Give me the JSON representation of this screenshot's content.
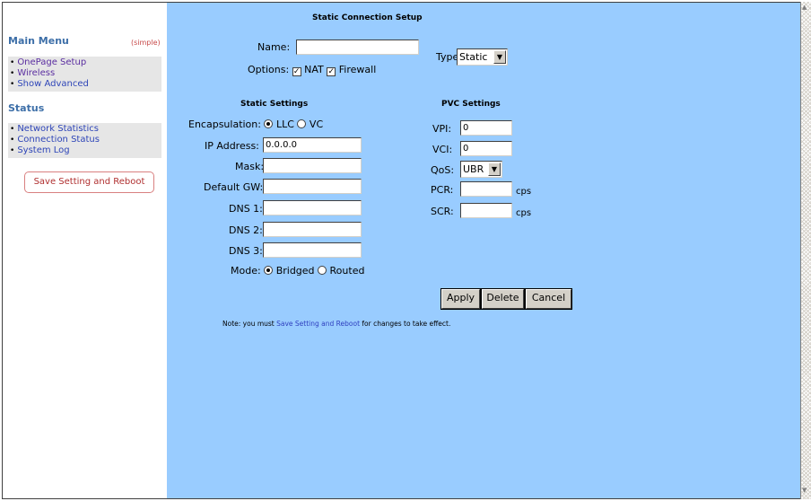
{
  "sidebar": {
    "main_menu_title": "Main Menu",
    "simple_link": "(simple)",
    "main_items": [
      {
        "label": "OnePage Setup"
      },
      {
        "label": "Wireless"
      },
      {
        "label": "Show Advanced"
      }
    ],
    "status_title": "Status",
    "status_items": [
      {
        "label": "Network Statistics"
      },
      {
        "label": "Connection Status"
      },
      {
        "label": "System Log"
      }
    ],
    "save_button": "Save Setting and Reboot"
  },
  "form": {
    "title": "Static Connection Setup",
    "name_label": "Name:",
    "name_value": "",
    "type_label": "Type:",
    "type_value": "Static",
    "options_label": "Options:",
    "nat_label": "NAT",
    "nat_checked": true,
    "firewall_label": "Firewall",
    "firewall_checked": true,
    "static_heading": "Static Settings",
    "pvc_heading": "PVC Settings",
    "encapsulation_label": "Encapsulation:",
    "llc_label": "LLC",
    "vc_label": "VC",
    "encapsulation_selected": "LLC",
    "ip_label": "IP Address:",
    "ip_value": "0.0.0.0",
    "mask_label": "Mask:",
    "mask_value": "",
    "gw_label": "Default GW:",
    "gw_value": "",
    "dns1_label": "DNS 1:",
    "dns1_value": "",
    "dns2_label": "DNS 2:",
    "dns2_value": "",
    "dns3_label": "DNS 3:",
    "dns3_value": "",
    "mode_label": "Mode:",
    "bridged_label": "Bridged",
    "routed_label": "Routed",
    "mode_selected": "Bridged",
    "vpi_label": "VPI:",
    "vpi_value": "0",
    "vci_label": "VCI:",
    "vci_value": "0",
    "qos_label": "QoS:",
    "qos_value": "UBR",
    "pcr_label": "PCR:",
    "pcr_value": "",
    "pcr_unit": "cps",
    "scr_label": "SCR:",
    "scr_value": "",
    "scr_unit": "cps",
    "apply_button": "Apply",
    "delete_button": "Delete",
    "cancel_button": "Cancel",
    "note_prefix": "Note: you must ",
    "note_link": "Save Setting and Reboot",
    "note_suffix": " for changes to take effect."
  },
  "colors": {
    "main_bg": "#99ccff",
    "sidebar_heading": "#3d6fa8",
    "link_purple": "#5a2da0",
    "link_blue": "#2e45b8"
  }
}
